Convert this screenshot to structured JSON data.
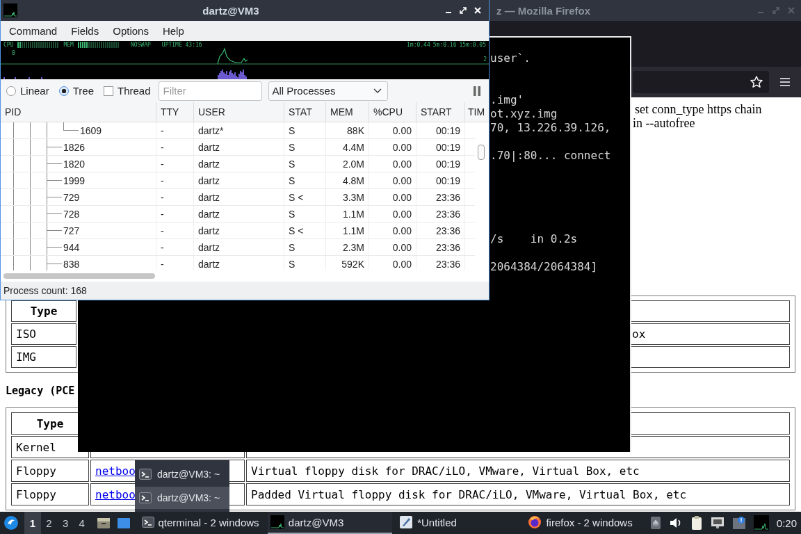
{
  "firefox_window": {
    "title": "z — Mozilla Firefox",
    "page": {
      "lines": [
        "set conn_type https chain",
        "in --autofree"
      ],
      "table_1": {
        "rows": [
          {
            "kind": "header",
            "column_1": "Type"
          },
          {
            "kind": "data",
            "column_1": "ISO",
            "column_2": "ox"
          },
          {
            "kind": "data",
            "column_1": "IMG"
          }
        ]
      },
      "heading": "Legacy (PCE",
      "table_2": {
        "rows": [
          {
            "kind": "header",
            "column_1": "Type"
          },
          {
            "kind": "data",
            "column_1": "Kernel"
          },
          {
            "kind": "data",
            "column_1": "Floppy",
            "column_2": "netboo",
            "column_3": "Virtual floppy disk for DRAC/iLO, VMware, Virtual Box, etc"
          },
          {
            "kind": "data",
            "column_1": "Floppy",
            "column_2": "netboo",
            "column_3": "Padded Virtual floppy disk for DRAC/iLO, VMware, Virtual Box, etc"
          }
        ]
      }
    }
  },
  "terminal_window": {
    "lines": [
      "user`.",
      ".img'",
      "ot.xyz.img",
      "70, 13.226.39.126,",
      ".70|:80... connect",
      "/s    in 0.2s",
      "2064384/2064384]"
    ]
  },
  "process_window": {
    "title": "dartz@VM3",
    "menu": [
      "Command",
      "Fields",
      "Options",
      "Help"
    ],
    "graph": {
      "cpu_label": "CPU",
      "cpu_meter": {
        "level": 0.1
      },
      "mem_label": "MEM",
      "mem_meter": {
        "level": 0.27
      },
      "swap_label": "NOSWAP",
      "uptime": "UPTIME 43:16",
      "load": [
        "1m:0.44",
        "5m:0.16",
        "15m:0.05"
      ],
      "scale_low": "0",
      "scale_high": "2"
    },
    "view_modes": [
      {
        "label": "Linear",
        "selected": false
      },
      {
        "label": "Tree",
        "selected": true
      }
    ],
    "thread": {
      "label": "Thread",
      "checked": false
    },
    "filter": {
      "placeholder": "Filter"
    },
    "process_filter": {
      "value": "All Processes"
    },
    "columns": [
      "PID",
      "TTY",
      "USER",
      "STAT",
      "MEM",
      "%CPU",
      "START",
      "TIM"
    ],
    "processes": [
      {
        "children": [
          {
            "pid": "1609",
            "tty": "-",
            "user": "dartz*",
            "stat": "S",
            "mem": "88K",
            "cpu": "0.00",
            "start": "00:19"
          }
        ]
      },
      {
        "pid": "1826",
        "tty": "-",
        "user": "dartz",
        "stat": "S",
        "mem": "4.4M",
        "cpu": "0.00",
        "start": "00:19"
      },
      {
        "pid": "1820",
        "tty": "-",
        "user": "dartz",
        "stat": "S",
        "mem": "2.0M",
        "cpu": "0.00",
        "start": "00:19"
      },
      {
        "pid": "1999",
        "tty": "-",
        "user": "dartz",
        "stat": "S",
        "mem": "4.8M",
        "cpu": "0.00",
        "start": "00:19"
      },
      {
        "pid": "729",
        "tty": "-",
        "user": "dartz",
        "stat": "S <",
        "mem": "3.3M",
        "cpu": "0.00",
        "start": "23:36"
      },
      {
        "pid": "728",
        "tty": "-",
        "user": "dartz",
        "stat": "S",
        "mem": "1.1M",
        "cpu": "0.00",
        "start": "23:36"
      },
      {
        "pid": "727",
        "tty": "-",
        "user": "dartz",
        "stat": "S <",
        "mem": "1.1M",
        "cpu": "0.00",
        "start": "23:36"
      },
      {
        "pid": "944",
        "tty": "-",
        "user": "dartz",
        "stat": "S",
        "mem": "2.3M",
        "cpu": "0.00",
        "start": "23:36"
      },
      {
        "pid": "838",
        "tty": "-",
        "user": "dartz",
        "stat": "S",
        "mem": "592K",
        "cpu": "0.00",
        "start": "23:36"
      }
    ],
    "status": "Process count: 168"
  },
  "task_popup": {
    "items": [
      {
        "label": "dartz@VM3: ~",
        "selected": false
      },
      {
        "label": "dartz@VM3: ~",
        "selected": true
      }
    ]
  },
  "taskbar": {
    "desktops": [
      {
        "label": "1",
        "selected": true
      },
      {
        "label": "2",
        "selected": false
      },
      {
        "label": "3",
        "selected": false
      },
      {
        "label": "4",
        "selected": false
      }
    ],
    "tasks": [
      {
        "kind": "terminal",
        "label": "qterminal - 2 windows",
        "active": false
      },
      {
        "kind": "monitor",
        "label": "dartz@VM3",
        "active": true
      },
      {
        "kind": "editor",
        "label": "*Untitled",
        "active": false
      },
      {
        "kind": "firefox",
        "label": "firefox - 2 windows",
        "active": false
      }
    ],
    "clock": "0:20"
  }
}
